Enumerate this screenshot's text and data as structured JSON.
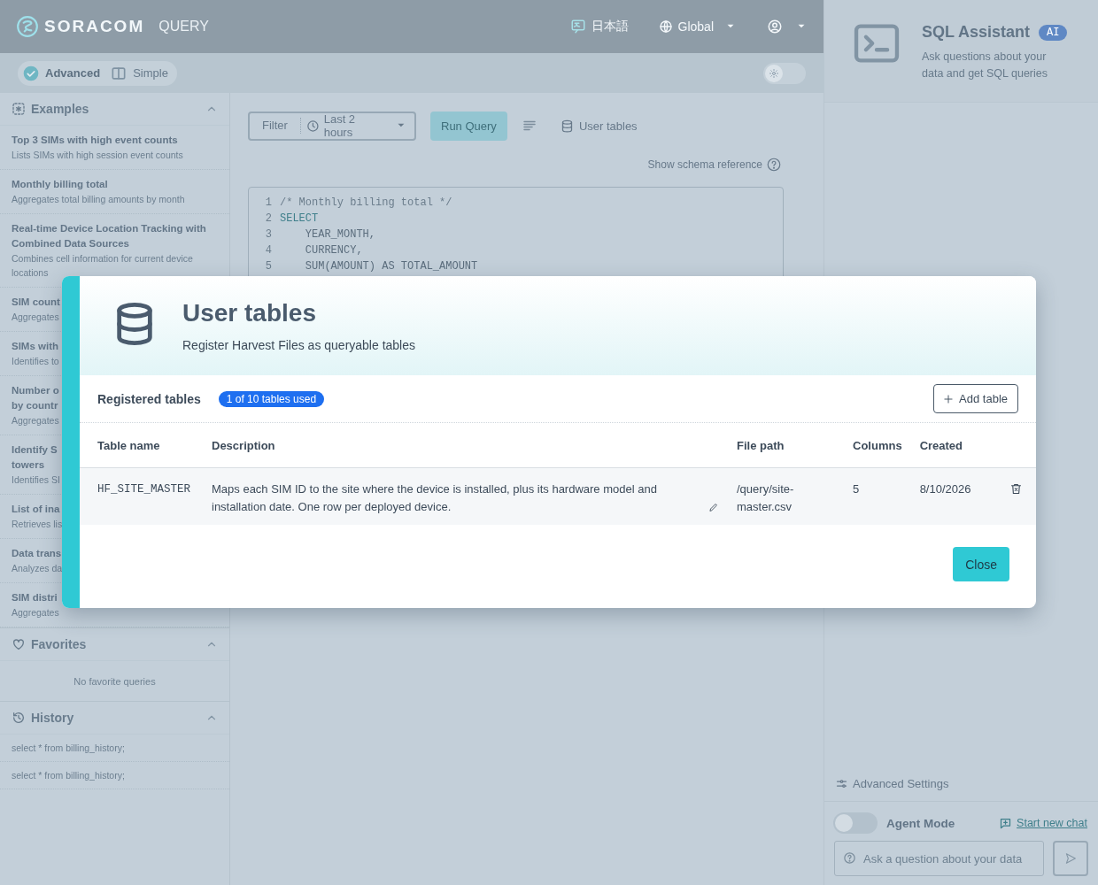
{
  "header": {
    "logo": "SORACOM",
    "product": "QUERY",
    "language": "日本語",
    "region": "Global"
  },
  "mode_tabs": [
    {
      "label": "Advanced",
      "selected": true
    },
    {
      "label": "Simple",
      "selected": false
    }
  ],
  "theme_toggle": {
    "on": false
  },
  "sidebar": {
    "examples": {
      "title": "Examples",
      "expanded": true,
      "items": [
        {
          "title": "Top 3 SIMs with high event counts",
          "description": "Lists SIMs with high session event counts"
        },
        {
          "title": "Monthly billing total",
          "description": "Aggregates total billing amounts by month"
        },
        {
          "title": "Real-time Device Location Tracking with Combined Data Sources",
          "description": "Combines cell information for current device locations"
        },
        {
          "title": "SIM count",
          "description": "Aggregates"
        },
        {
          "title": "SIMs with",
          "description": "Identifies to"
        },
        {
          "title": "Number o\nby countr",
          "description": "Aggregates"
        },
        {
          "title": "Identify S\ntowers",
          "description": "Identifies SI"
        },
        {
          "title": "List of ina",
          "description": "Retrieves lis"
        },
        {
          "title": "Data trans",
          "description": "Analyzes da"
        },
        {
          "title": "SIM distri",
          "description": "Aggregates"
        }
      ]
    },
    "favorites": {
      "title": "Favorites",
      "expanded": true,
      "empty_text": "No favorite queries"
    },
    "history": {
      "title": "History",
      "expanded": true,
      "items": [
        "select * from billing_history;",
        "select * from billing_history;"
      ]
    }
  },
  "toolbar": {
    "filter": "Filter",
    "time_range": "Last 2 hours",
    "run_button": "Run Query",
    "user_tables": "User tables"
  },
  "schema_link": "Show schema reference",
  "editor": {
    "lines": [
      {
        "number": "1",
        "code": "/* Monthly billing total */",
        "kind": "comment"
      },
      {
        "number": "2",
        "code": "SELECT",
        "kind": "keyword"
      },
      {
        "number": "3",
        "code": "    YEAR_MONTH,",
        "kind": "plain"
      },
      {
        "number": "4",
        "code": "    CURRENCY,",
        "kind": "plain"
      },
      {
        "number": "5",
        "code": "    SUM(AMOUNT) AS TOTAL_AMOUNT",
        "kind": "plain"
      }
    ]
  },
  "assistant": {
    "title": "SQL Assistant",
    "badge": "AI",
    "subtitle": "Ask questions about your data and get SQL queries",
    "advanced_settings": "Advanced Settings",
    "agent_mode": {
      "label": "Agent Mode",
      "on": false
    },
    "new_chat": "Start new chat",
    "input": {
      "placeholder": "Ask a question about your data"
    }
  },
  "modal": {
    "title": "User tables",
    "subtitle": "Register Harvest Files as queryable tables",
    "section_title": "Registered tables",
    "usage_badge": "1 of 10 tables used",
    "add_button": "Add table",
    "columns": [
      "Table name",
      "Description",
      "File path",
      "Columns",
      "Created"
    ],
    "rows": [
      {
        "table_name": "HF_SITE_MASTER",
        "description": "Maps each SIM ID to the site where the device is installed, plus its hardware model and installation date. One row per deployed device.",
        "file_path": "/query/site-master.csv",
        "columns": "5",
        "created": "8/10/2026"
      }
    ],
    "close_button": "Close"
  }
}
